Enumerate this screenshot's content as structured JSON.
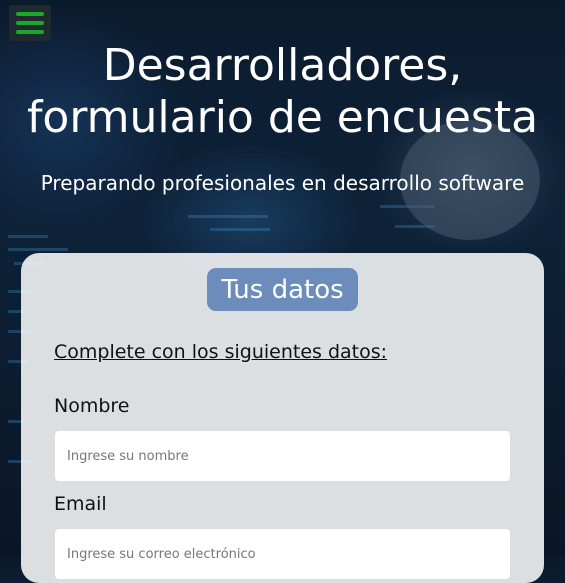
{
  "menu": {
    "icon": "hamburger-menu-icon",
    "color": "#19a82a"
  },
  "header": {
    "title": "Desarrolladores, formulario de encuesta",
    "subtitle": "Preparando profesionales en desarrollo software"
  },
  "form": {
    "section_title": "Tus datos",
    "instruction": "Complete con los siguientes datos:",
    "fields": [
      {
        "label": "Nombre",
        "placeholder": "Ingrese su nombre"
      },
      {
        "label": "Email",
        "placeholder": "Ingrese su correo electrónico"
      }
    ]
  },
  "colors": {
    "badge": "#6c8cbb",
    "card": "#ffffff"
  }
}
